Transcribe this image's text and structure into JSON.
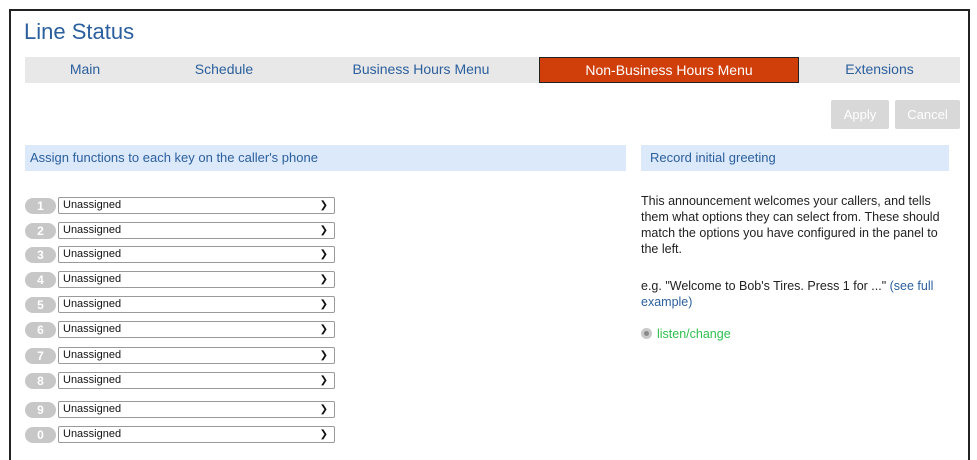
{
  "page": {
    "title": "Line Status"
  },
  "tabs": [
    {
      "label": "Main"
    },
    {
      "label": "Schedule"
    },
    {
      "label": "Business Hours Menu"
    },
    {
      "label": "Non-Business Hours Menu",
      "active": true
    },
    {
      "label": "Extensions"
    }
  ],
  "actions": {
    "apply": "Apply",
    "cancel": "Cancel"
  },
  "left_panel": {
    "header": "Assign functions to each key on the caller's phone",
    "keys": [
      {
        "key": "1",
        "value": "Unassigned"
      },
      {
        "key": "2",
        "value": "Unassigned"
      },
      {
        "key": "3",
        "value": "Unassigned"
      },
      {
        "key": "4",
        "value": "Unassigned"
      },
      {
        "key": "5",
        "value": "Unassigned"
      },
      {
        "key": "6",
        "value": "Unassigned"
      },
      {
        "key": "7",
        "value": "Unassigned"
      },
      {
        "key": "8",
        "value": "Unassigned"
      },
      {
        "key": "9",
        "value": "Unassigned"
      },
      {
        "key": "0",
        "value": "Unassigned"
      }
    ]
  },
  "right_panel": {
    "header": "Record initial greeting",
    "description": "This announcement welcomes your callers, and tells them what options they can select from. These should match the options you have configured in the panel to the left.",
    "example_text": "e.g. \"Welcome to Bob's Tires. Press 1 for ...\"",
    "example_link": "(see full example)",
    "listen_link": "listen/change"
  },
  "colors": {
    "active_tab": "#d03e0a",
    "title": "#2b5f9e",
    "panel_header": "#dbe9fb",
    "listen_link": "#2fbf4f"
  },
  "icons": {
    "dropdown": "chevron-down-icon",
    "speaker": "speaker-icon"
  }
}
